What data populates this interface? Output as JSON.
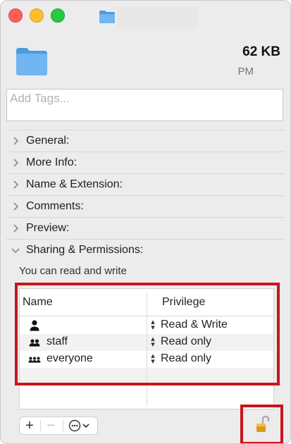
{
  "window": {
    "size": "62 KB",
    "modified": "PM"
  },
  "tags": {
    "placeholder": "Add Tags..."
  },
  "sections": [
    {
      "label": "General:",
      "expanded": false
    },
    {
      "label": "More Info:",
      "expanded": false
    },
    {
      "label": "Name & Extension:",
      "expanded": false
    },
    {
      "label": "Comments:",
      "expanded": false
    },
    {
      "label": "Preview:",
      "expanded": false
    },
    {
      "label": "Sharing & Permissions:",
      "expanded": true
    }
  ],
  "permissions": {
    "note": "You can read and write",
    "columns": {
      "name": "Name",
      "privilege": "Privilege"
    },
    "rows": [
      {
        "icon": "user-icon",
        "name": "",
        "privilege": "Read & Write"
      },
      {
        "icon": "group-icon",
        "name": "staff",
        "privilege": "Read only"
      },
      {
        "icon": "everyone-icon",
        "name": "everyone",
        "privilege": "Read only"
      }
    ]
  },
  "toolbar": {
    "add_label": "+",
    "remove_label": "−",
    "action_icon": "ellipsis-circle-icon"
  },
  "lock": {
    "icon": "lock-open-icon",
    "state": "unlocked"
  },
  "colors": {
    "highlight": "#c8161e",
    "folder": "#5aa9ec",
    "close": "#fe5f57",
    "minimize": "#febc2e",
    "zoom": "#28c840"
  }
}
